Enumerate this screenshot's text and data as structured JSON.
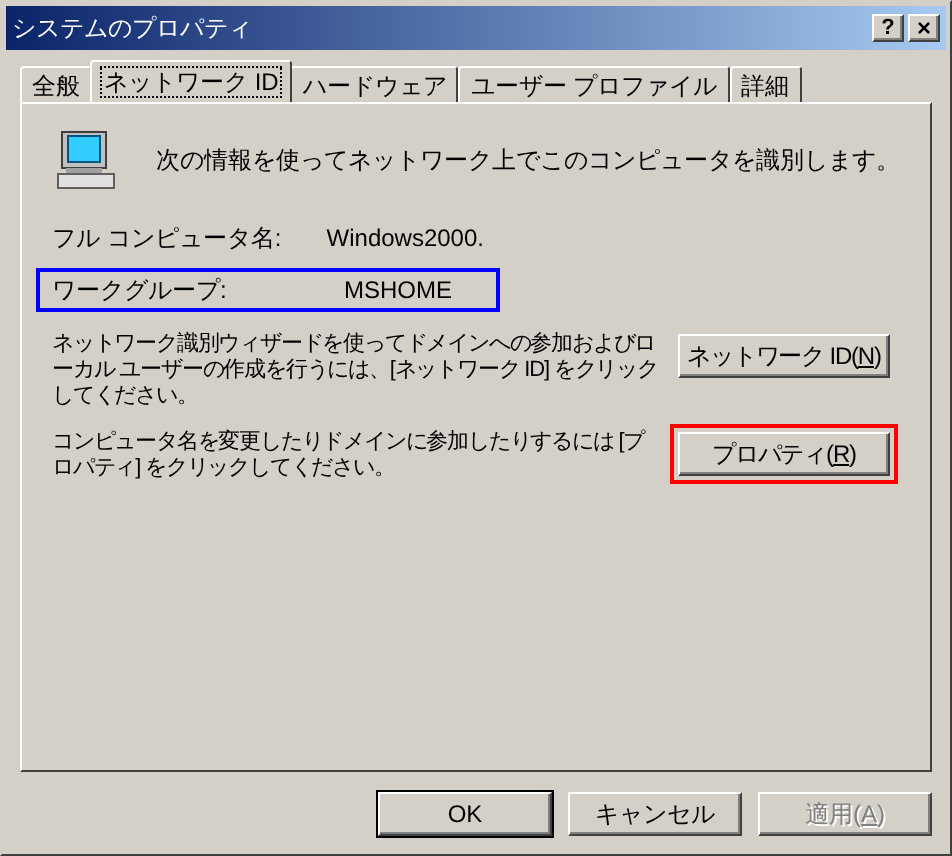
{
  "window": {
    "title": "システムのプロパティ",
    "help": "?",
    "close": "×"
  },
  "tabs": [
    {
      "label": "全般",
      "selected": false
    },
    {
      "label": "ネットワーク ID",
      "selected": true
    },
    {
      "label": "ハードウェア",
      "selected": false
    },
    {
      "label": "ユーザー プロファイル",
      "selected": false
    },
    {
      "label": "詳細",
      "selected": false
    }
  ],
  "intro": "次の情報を使ってネットワーク上でこのコンピュータを識別します。",
  "fields": [
    {
      "label": "フル コンピュータ名:",
      "value": "Windows2000."
    },
    {
      "label": "ワークグループ:",
      "value": "MSHOME",
      "color": "#0000ff"
    }
  ],
  "actions": [
    {
      "text": "ネットワーク識別ウィザードを使ってドメインへの参加およびローカル ユーザーの作成を行うには、[ネットワーク ID] をクリックしてください。",
      "button": {
        "before": "ネットワーク ID(",
        "accesskey": "N",
        "after": ")"
      }
    },
    {
      "text": "コンピュータ名を変更したりドメインに参加したりするには [プロパティ] をクリックしてください。",
      "button": {
        "before": "プロパティ(",
        "accesskey": "R",
        "after": ")"
      },
      "color": "#ff0000"
    }
  ],
  "buttons": [
    {
      "before": "OK",
      "disabled": false,
      "default": true
    },
    {
      "before": "キャンセル",
      "disabled": false,
      "default": false
    },
    {
      "before": "適用(",
      "accesskey": "A",
      "after": ")",
      "disabled": true,
      "default": false
    }
  ]
}
